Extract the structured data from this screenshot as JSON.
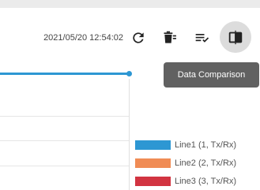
{
  "header": {
    "timestamp": "2021/05/20 12:54:02"
  },
  "toolbar": {
    "buttons": [
      {
        "icon": "refresh-icon"
      },
      {
        "icon": "delete-icon"
      },
      {
        "icon": "list-check-icon"
      },
      {
        "icon": "data-comparison-icon",
        "active": true
      }
    ],
    "tooltip": "Data Comparison"
  },
  "chart": {
    "line_color": "#2d97d3",
    "legend": [
      {
        "label": "Line1 (1, Tx/Rx)",
        "color": "#2d97d3"
      },
      {
        "label": "Line2 (2, Tx/Rx)",
        "color": "#f08c55"
      },
      {
        "label": "Line3 (3, Tx/Rx)",
        "color": "#d23441"
      }
    ]
  }
}
